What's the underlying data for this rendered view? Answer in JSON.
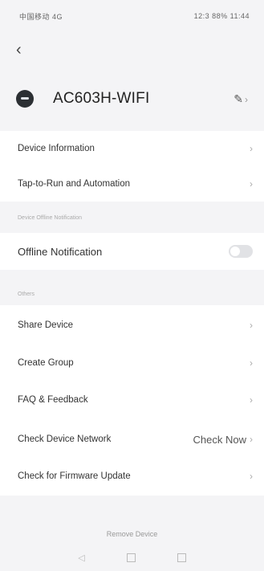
{
  "status": {
    "left": "中国移动 4G",
    "right": "12:3 88% 11:44"
  },
  "header": {
    "back_icon": "chevron-left-icon",
    "device_name": "AC603H-WIFI",
    "edit_icon": "pencil-icon"
  },
  "rows": {
    "device_information": "Device Information",
    "tap_to_run": "Tap-to-Run and Automation",
    "section_offline": "Device Offline Notification",
    "offline_notification": "Offline Notification",
    "section_others": "Others",
    "share_device": "Share Device",
    "create_group": "Create Group",
    "faq_feedback": "FAQ & Feedback",
    "check_network": "Check Device Network",
    "check_now": "Check Now",
    "check_firmware": "Check for Firmware Update"
  },
  "footer": {
    "remove_device": "Remove Device"
  },
  "offline_toggle_on": false
}
